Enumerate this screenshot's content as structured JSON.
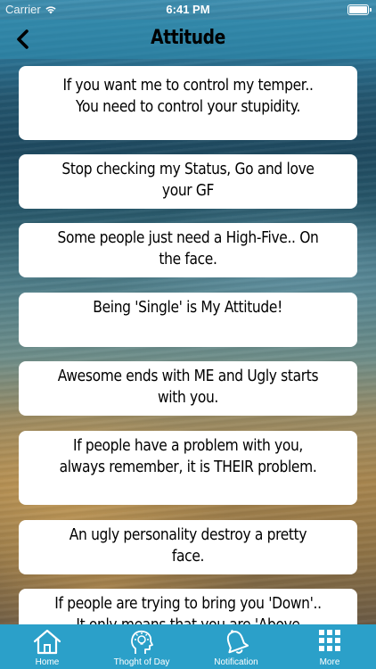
{
  "status": {
    "carrier": "Carrier",
    "time": "6:41 PM"
  },
  "nav": {
    "title": "Attitude",
    "back_icon": "chevron-left-icon"
  },
  "quotes": [
    "If you want me to control my temper.. You need to control your stupidity.",
    "Stop checking my Status, Go and love your GF",
    "Some people just need a High-Five.. On the face.",
    "Being 'Single' is My Attitude!",
    "Awesome ends with ME and Ugly starts with you.",
    "If people have a problem with you, always remember, it is THEIR problem.",
    "An ugly personality destroy a pretty face.",
    "If people are trying to bring you 'Down'.. It only means that you are 'Above them'."
  ],
  "tabbar": {
    "tabs": [
      {
        "label": "Home",
        "icon": "home-icon"
      },
      {
        "label": "Thoght of Day",
        "icon": "idea-head-icon"
      },
      {
        "label": "Notification",
        "icon": "bell-icon"
      },
      {
        "label": "More",
        "icon": "grid-icon"
      }
    ]
  },
  "colors": {
    "tabbar_bg": "#2ba0c9",
    "navbar_bg": "#2d8caf",
    "card_bg": "#ffffff"
  }
}
